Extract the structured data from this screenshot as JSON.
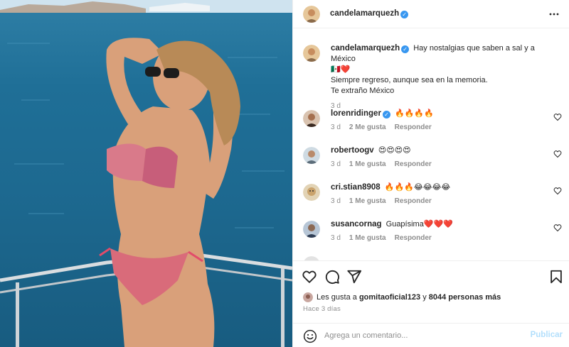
{
  "post": {
    "author": "candelamarquezh",
    "more_icon": "more-horizontal-icon"
  },
  "caption": {
    "author": "candelamarquezh",
    "line1": "Hay nostalgias que saben a sal y a México",
    "flags": "🇲🇽❤️",
    "line2": "Siempre regreso, aunque sea en la memoria.",
    "line3": "Te extraño México",
    "time": "3 d"
  },
  "comments": [
    {
      "user": "lorenridinger",
      "verified": true,
      "text": "🔥🔥🔥🔥",
      "time": "3 d",
      "likes": "2 Me gusta",
      "reply": "Responder"
    },
    {
      "user": "robertoogv",
      "verified": false,
      "text": "😍😍😍😍",
      "time": "3 d",
      "likes": "1 Me gusta",
      "reply": "Responder"
    },
    {
      "user": "cri.stian8908",
      "verified": false,
      "text": "🔥🔥🔥😂😂😂😂",
      "time": "3 d",
      "likes": "1 Me gusta",
      "reply": "Responder"
    },
    {
      "user": "susancornag",
      "verified": false,
      "text": "Guapísima❤️❤️❤️",
      "time": "3 d",
      "likes": "1 Me gusta",
      "reply": "Responder"
    }
  ],
  "actions": {
    "likes_prefix": "Les gusta a",
    "likes_user": "gomitaoficial123",
    "likes_mid": "y",
    "likes_count": "8044 personas más",
    "ago": "Hace 3 días"
  },
  "composer": {
    "placeholder": "Agrega un comentario...",
    "publish": "Publicar"
  },
  "colors": {
    "accent": "#3897f0",
    "publish_disabled": "#b2dffc",
    "muted": "#8e8e8e"
  }
}
